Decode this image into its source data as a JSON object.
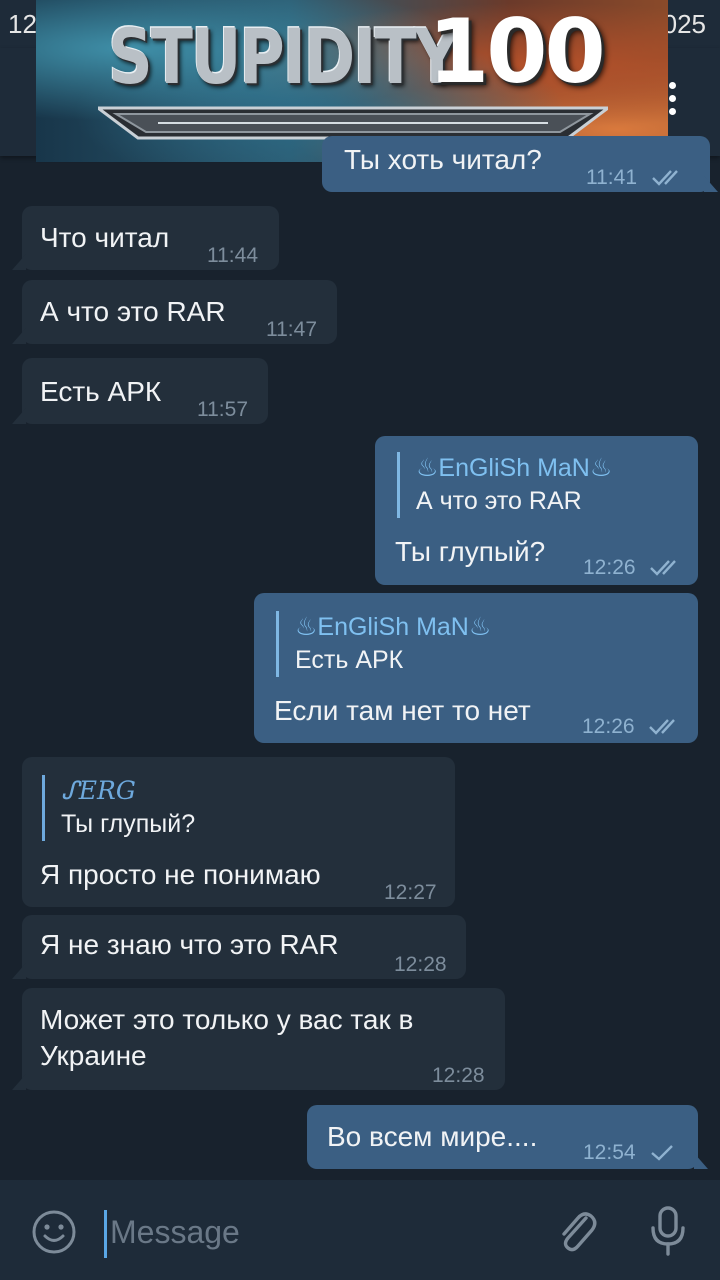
{
  "status_bar": {
    "time": "12",
    "clock_right": "025"
  },
  "meme": {
    "caption": "STUPIDITY",
    "level": "100"
  },
  "messages": [
    {
      "dir": "out",
      "text": "Ты хоть читал?",
      "time": "11:41",
      "read": true
    },
    {
      "dir": "in",
      "text": "Что читал",
      "time": "11:44"
    },
    {
      "dir": "in",
      "text": "А что это RAR",
      "time": "11:47"
    },
    {
      "dir": "in",
      "text": "Есть АРК",
      "time": "11:57"
    },
    {
      "dir": "out",
      "reply_name": "♨EnGliSh MaN♨",
      "reply_text": "А что это RAR",
      "text": "Ты глупый?",
      "time": "12:26",
      "read": true
    },
    {
      "dir": "out",
      "reply_name": "♨EnGliSh MaN♨",
      "reply_text": "Есть АРК",
      "text": "Если там нет то нет",
      "time": "12:26",
      "read": true
    },
    {
      "dir": "in",
      "reply_name": "ᔑERG",
      "reply_text": "Ты глупый?",
      "text": "Я просто не понимаю",
      "time": "12:27"
    },
    {
      "dir": "in",
      "text": "Я не знаю что это RAR",
      "time": "12:28"
    },
    {
      "dir": "in",
      "text_line1": "Может это только у вас так в",
      "text_line2": "Украине",
      "time": "12:28"
    },
    {
      "dir": "out",
      "text": "Во всем мире....",
      "time": "12:54",
      "read": false
    }
  ],
  "composer": {
    "placeholder": "Message"
  },
  "icons": {
    "emoji": "smiley-icon",
    "attach": "paperclip-icon",
    "mic": "microphone-icon",
    "menu": "more-vertical-icon",
    "read": "double-check-icon",
    "sent": "single-check-icon"
  },
  "colors": {
    "background": "#18222d",
    "incoming_bubble": "#232f3b",
    "outgoing_bubble": "#3b5f83",
    "accent": "#5aa7e6"
  }
}
